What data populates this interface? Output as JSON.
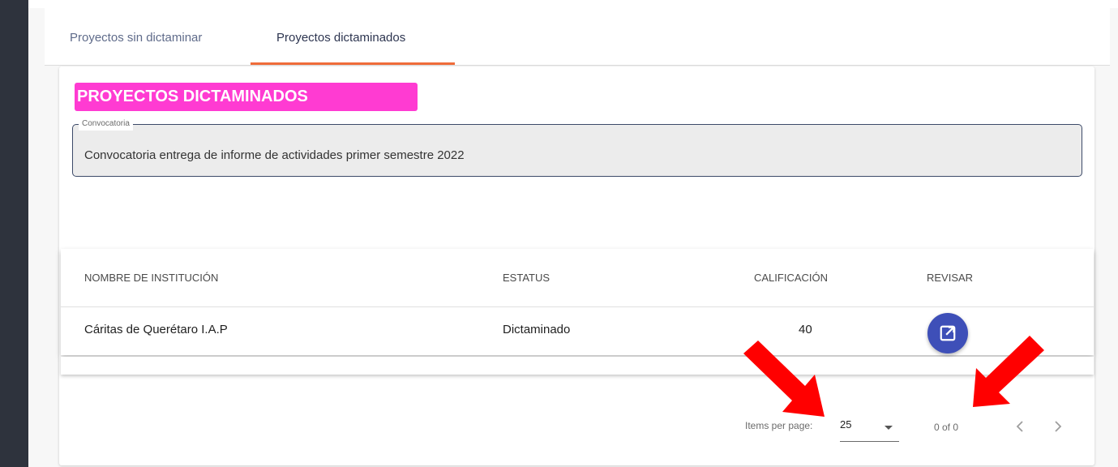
{
  "tabs": [
    {
      "label": "Proyectos sin dictaminar"
    },
    {
      "label": "Proyectos dictaminados"
    }
  ],
  "section_title": "PROYECTOS DICTAMINADOS",
  "convocatoria": {
    "label": "Convocatoria",
    "value": "Convocatoria entrega de informe de actividades primer semestre 2022"
  },
  "table": {
    "headers": [
      "NOMBRE DE INSTITUCIÓN",
      "ESTATUS",
      "CALIFICACIÓN",
      "REVISAR"
    ],
    "rows": [
      {
        "institucion": "Cáritas de Querétaro I.A.P",
        "estatus": "Dictaminado",
        "calificacion": "40",
        "revisar_icon": "open-in-new-icon"
      }
    ]
  },
  "paginator": {
    "items_label": "Items per page:",
    "page_size": "25",
    "range": "0 of 0"
  },
  "colors": {
    "heading_bg": "#ff3bd2",
    "tab_ink": "#ef6c3a",
    "fab": "#3e4fb8",
    "annotation_arrow": "#ff0000"
  }
}
